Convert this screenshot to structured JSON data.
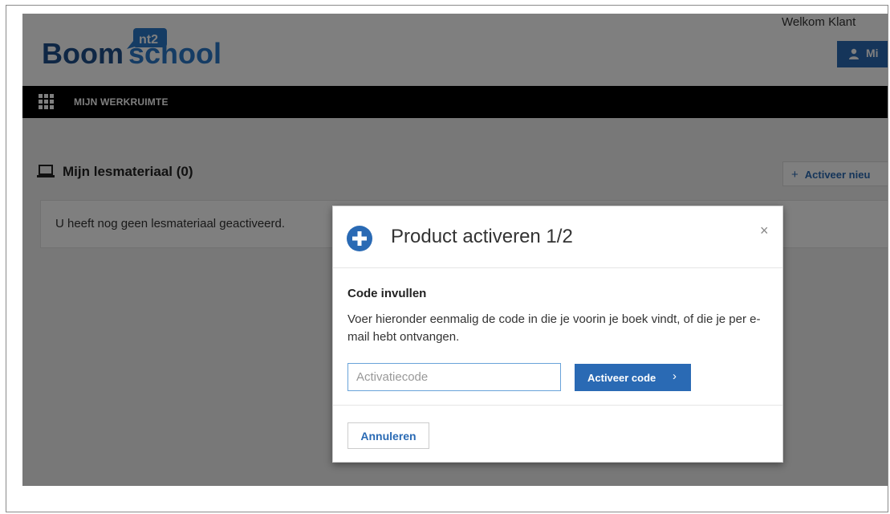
{
  "header": {
    "logo_text_left": "Boom",
    "logo_badge": "nt2",
    "logo_text_right": "school",
    "welcome": "Welkom Klant",
    "account_label": "Mi",
    "brand_color": "#2a6ab4"
  },
  "nav": {
    "menu_label": "MIJN WERKRUIMTE"
  },
  "main": {
    "section_title": "Mijn lesmateriaal (0)",
    "activate_new_label": "Activeer nieu",
    "empty_message": "U heeft nog geen lesmateriaal geactiveerd."
  },
  "modal": {
    "title": "Product activeren 1/2",
    "close_label": "×",
    "heading": "Code invullen",
    "description": "Voer hieronder eenmalig de code in die je voorin je boek vindt, of die je per e-mail hebt ontvangen.",
    "input_value": "",
    "input_placeholder": "Activatiecode",
    "activate_button": "Activeer code",
    "activate_chevron": "›",
    "cancel_button": "Annuleren"
  },
  "icons": {
    "grid": "grid-icon",
    "user": "user-icon",
    "laptop": "laptop-icon",
    "plus": "plus-icon",
    "plus_circle": "plus-circle-icon",
    "close": "close-icon",
    "chevron": "chevron-right-icon"
  }
}
